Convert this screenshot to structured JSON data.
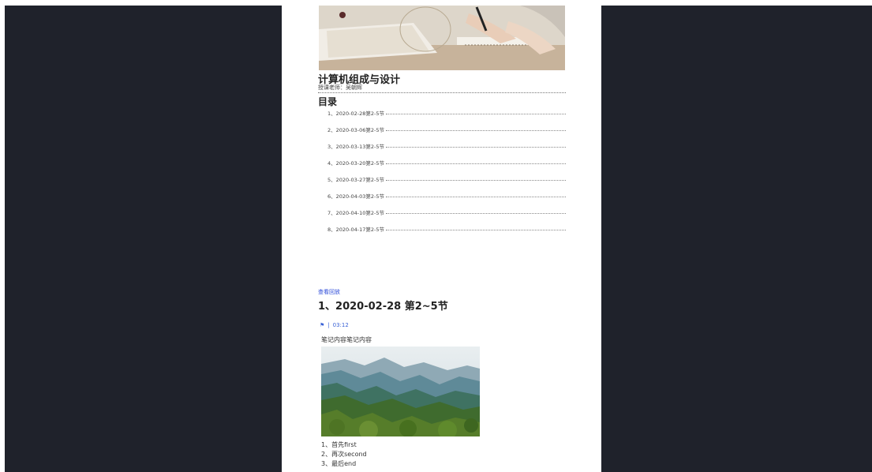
{
  "course": {
    "title": "计算机组成与设计",
    "teacher": "授课老师：吴朝辉"
  },
  "toc": {
    "title": "目录",
    "items": [
      "1、2020-02-28第2-5节",
      "2、2020-03-06第2-5节",
      "3、2020-03-13第2-5节",
      "4、2020-03-20第2-5节",
      "5、2020-03-27第2-5节",
      "6、2020-04-03第2-5节",
      "7、2020-04-10第2-5节",
      "8、2020-04-17第2-5节"
    ]
  },
  "section": {
    "replay_link": "查看回放",
    "title": "1、2020-02-28 第2~5节",
    "timestamp": "03:12",
    "flag_icon": "flag-icon",
    "note": "笔记内容笔记内容",
    "steps": [
      "1、首先first",
      "2、再次second",
      "3、最后end"
    ]
  },
  "colors": {
    "backdrop": "#1f222b",
    "page": "#ffffff",
    "link": "#2b4ad8",
    "timestamp": "#3a62d6"
  }
}
